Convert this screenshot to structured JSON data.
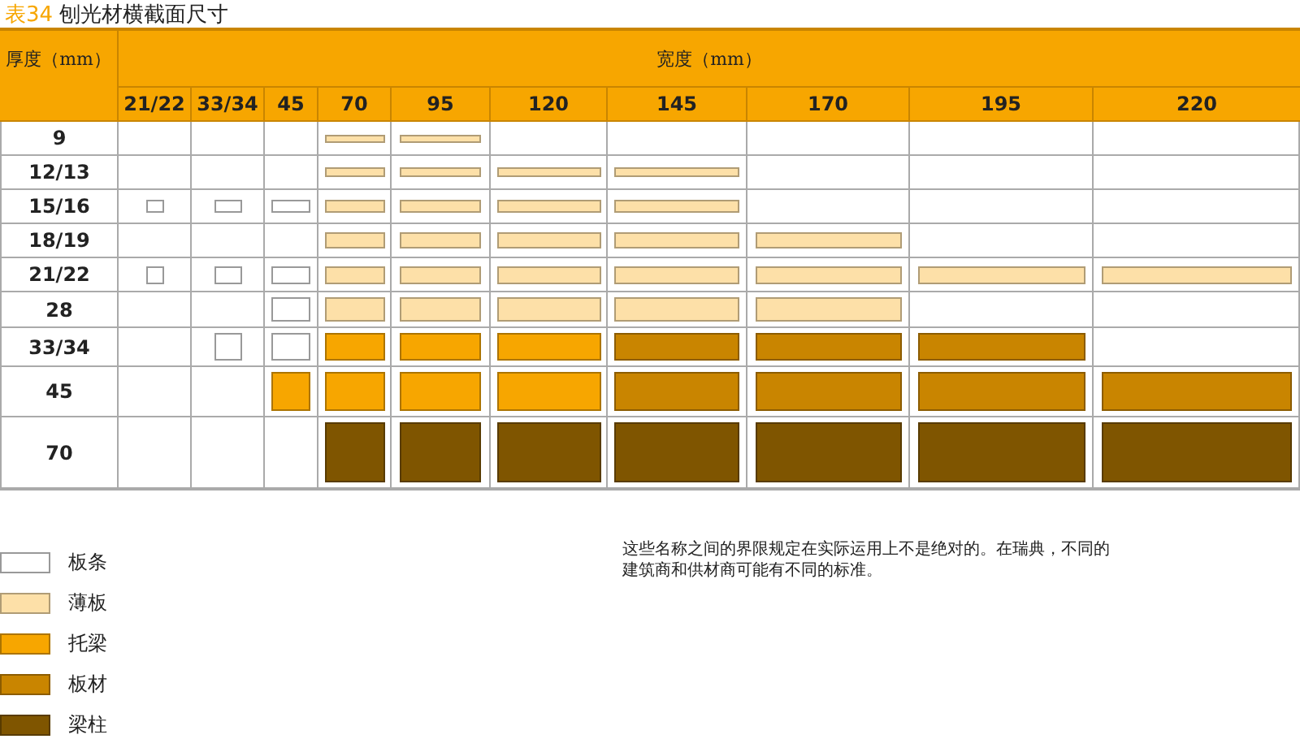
{
  "title": {
    "label": "表34",
    "text": "刨光材横截面尺寸"
  },
  "table": {
    "corner": "厚度（mm）",
    "width_header": "宽度（mm）",
    "columns": [
      "21/22",
      "33/34",
      "45",
      "70",
      "95",
      "120",
      "145",
      "170",
      "195",
      "220"
    ],
    "rows": [
      {
        "thickness": "9",
        "cells": [
          {
            "kind": "none"
          },
          {
            "kind": "none"
          },
          {
            "kind": "none"
          },
          {
            "kind": "thin"
          },
          {
            "kind": "thin"
          },
          {
            "kind": "none"
          },
          {
            "kind": "none"
          },
          {
            "kind": "none"
          },
          {
            "kind": "none"
          },
          {
            "kind": "none"
          }
        ]
      },
      {
        "thickness": "12/13",
        "cells": [
          {
            "kind": "none"
          },
          {
            "kind": "none"
          },
          {
            "kind": "none"
          },
          {
            "kind": "thin"
          },
          {
            "kind": "thin"
          },
          {
            "kind": "thin"
          },
          {
            "kind": "thin"
          },
          {
            "kind": "none"
          },
          {
            "kind": "none"
          },
          {
            "kind": "none"
          }
        ]
      },
      {
        "thickness": "15/16",
        "cells": [
          {
            "kind": "strip"
          },
          {
            "kind": "strip"
          },
          {
            "kind": "strip"
          },
          {
            "kind": "thin"
          },
          {
            "kind": "thin"
          },
          {
            "kind": "thin"
          },
          {
            "kind": "thin"
          },
          {
            "kind": "none"
          },
          {
            "kind": "none"
          },
          {
            "kind": "none"
          }
        ]
      },
      {
        "thickness": "18/19",
        "cells": [
          {
            "kind": "none"
          },
          {
            "kind": "none"
          },
          {
            "kind": "none"
          },
          {
            "kind": "thin"
          },
          {
            "kind": "thin"
          },
          {
            "kind": "thin"
          },
          {
            "kind": "thin"
          },
          {
            "kind": "thin"
          },
          {
            "kind": "none"
          },
          {
            "kind": "none"
          }
        ]
      },
      {
        "thickness": "21/22",
        "cells": [
          {
            "kind": "strip"
          },
          {
            "kind": "strip"
          },
          {
            "kind": "strip"
          },
          {
            "kind": "thin"
          },
          {
            "kind": "thin"
          },
          {
            "kind": "thin"
          },
          {
            "kind": "thin"
          },
          {
            "kind": "thin"
          },
          {
            "kind": "thin"
          },
          {
            "kind": "thin"
          }
        ]
      },
      {
        "thickness": "28",
        "cells": [
          {
            "kind": "none"
          },
          {
            "kind": "none"
          },
          {
            "kind": "strip"
          },
          {
            "kind": "thin"
          },
          {
            "kind": "thin"
          },
          {
            "kind": "thin"
          },
          {
            "kind": "thin"
          },
          {
            "kind": "thin"
          },
          {
            "kind": "none"
          },
          {
            "kind": "none"
          }
        ]
      },
      {
        "thickness": "33/34",
        "cells": [
          {
            "kind": "none"
          },
          {
            "kind": "strip"
          },
          {
            "kind": "strip"
          },
          {
            "kind": "joist"
          },
          {
            "kind": "joist"
          },
          {
            "kind": "joist"
          },
          {
            "kind": "plank"
          },
          {
            "kind": "plank"
          },
          {
            "kind": "plank"
          },
          {
            "kind": "none"
          }
        ]
      },
      {
        "thickness": "45",
        "cells": [
          {
            "kind": "none"
          },
          {
            "kind": "none"
          },
          {
            "kind": "joist"
          },
          {
            "kind": "joist"
          },
          {
            "kind": "joist"
          },
          {
            "kind": "joist"
          },
          {
            "kind": "plank"
          },
          {
            "kind": "plank"
          },
          {
            "kind": "plank"
          },
          {
            "kind": "plank"
          }
        ]
      },
      {
        "thickness": "70",
        "cells": [
          {
            "kind": "none"
          },
          {
            "kind": "none"
          },
          {
            "kind": "none"
          },
          {
            "kind": "beam"
          },
          {
            "kind": "beam"
          },
          {
            "kind": "beam"
          },
          {
            "kind": "beam"
          },
          {
            "kind": "beam"
          },
          {
            "kind": "beam"
          },
          {
            "kind": "beam"
          }
        ]
      }
    ]
  },
  "legend": [
    {
      "kind": "strip",
      "label": "板条",
      "color": "#ffffff"
    },
    {
      "kind": "thin",
      "label": "薄板",
      "color": "#fde0a8"
    },
    {
      "kind": "joist",
      "label": "托梁",
      "color": "#f7a600"
    },
    {
      "kind": "plank",
      "label": "板材",
      "color": "#c98500"
    },
    {
      "kind": "beam",
      "label": "梁柱",
      "color": "#7f5500"
    }
  ],
  "note": "这些名称之间的界限规定在实际运用上不是绝对的。在瑞典，不同的建筑商和供材商可能有不同的标准。"
}
